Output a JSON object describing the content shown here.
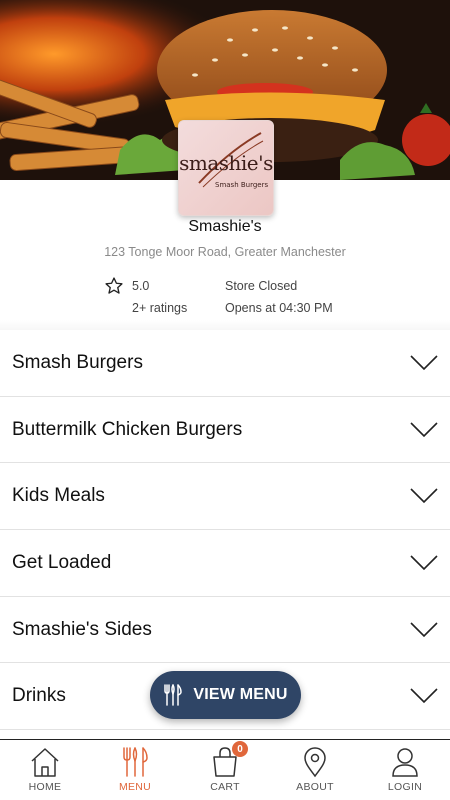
{
  "store": {
    "logo_text": "smashie's",
    "logo_subtext": "Smash Burgers",
    "name": "Smashie's",
    "address": "123 Tonge Moor Road, Greater Manchester",
    "rating": "5.0",
    "rating_count": "2+ ratings",
    "status": "Store Closed",
    "opens": "Opens at 04:30 PM"
  },
  "categories": [
    {
      "label": "Smash Burgers",
      "icon": "chevron-down-icon"
    },
    {
      "label": "Buttermilk Chicken Burgers",
      "icon": "chevron-down-icon"
    },
    {
      "label": "Kids Meals",
      "icon": "chevron-down-icon"
    },
    {
      "label": "Get Loaded",
      "icon": "chevron-down-icon"
    },
    {
      "label": "Smashie's Sides",
      "icon": "chevron-down-icon"
    },
    {
      "label": "Drinks",
      "icon": "chevron-down-icon"
    }
  ],
  "view_menu": {
    "label": "VIEW MENU",
    "icon": "cutlery-icon"
  },
  "nav": {
    "items": [
      {
        "label": "HOME",
        "icon": "home-icon"
      },
      {
        "label": "MENU",
        "icon": "cutlery-icon",
        "active": true
      },
      {
        "label": "CART",
        "icon": "bag-icon",
        "badge": "0"
      },
      {
        "label": "ABOUT",
        "icon": "location-pin-icon"
      },
      {
        "label": "LOGIN",
        "icon": "user-icon"
      }
    ]
  },
  "colors": {
    "accent": "#e0673b",
    "button_bg": "#2f4566",
    "text": "#111111",
    "muted": "#8a8a8a"
  }
}
